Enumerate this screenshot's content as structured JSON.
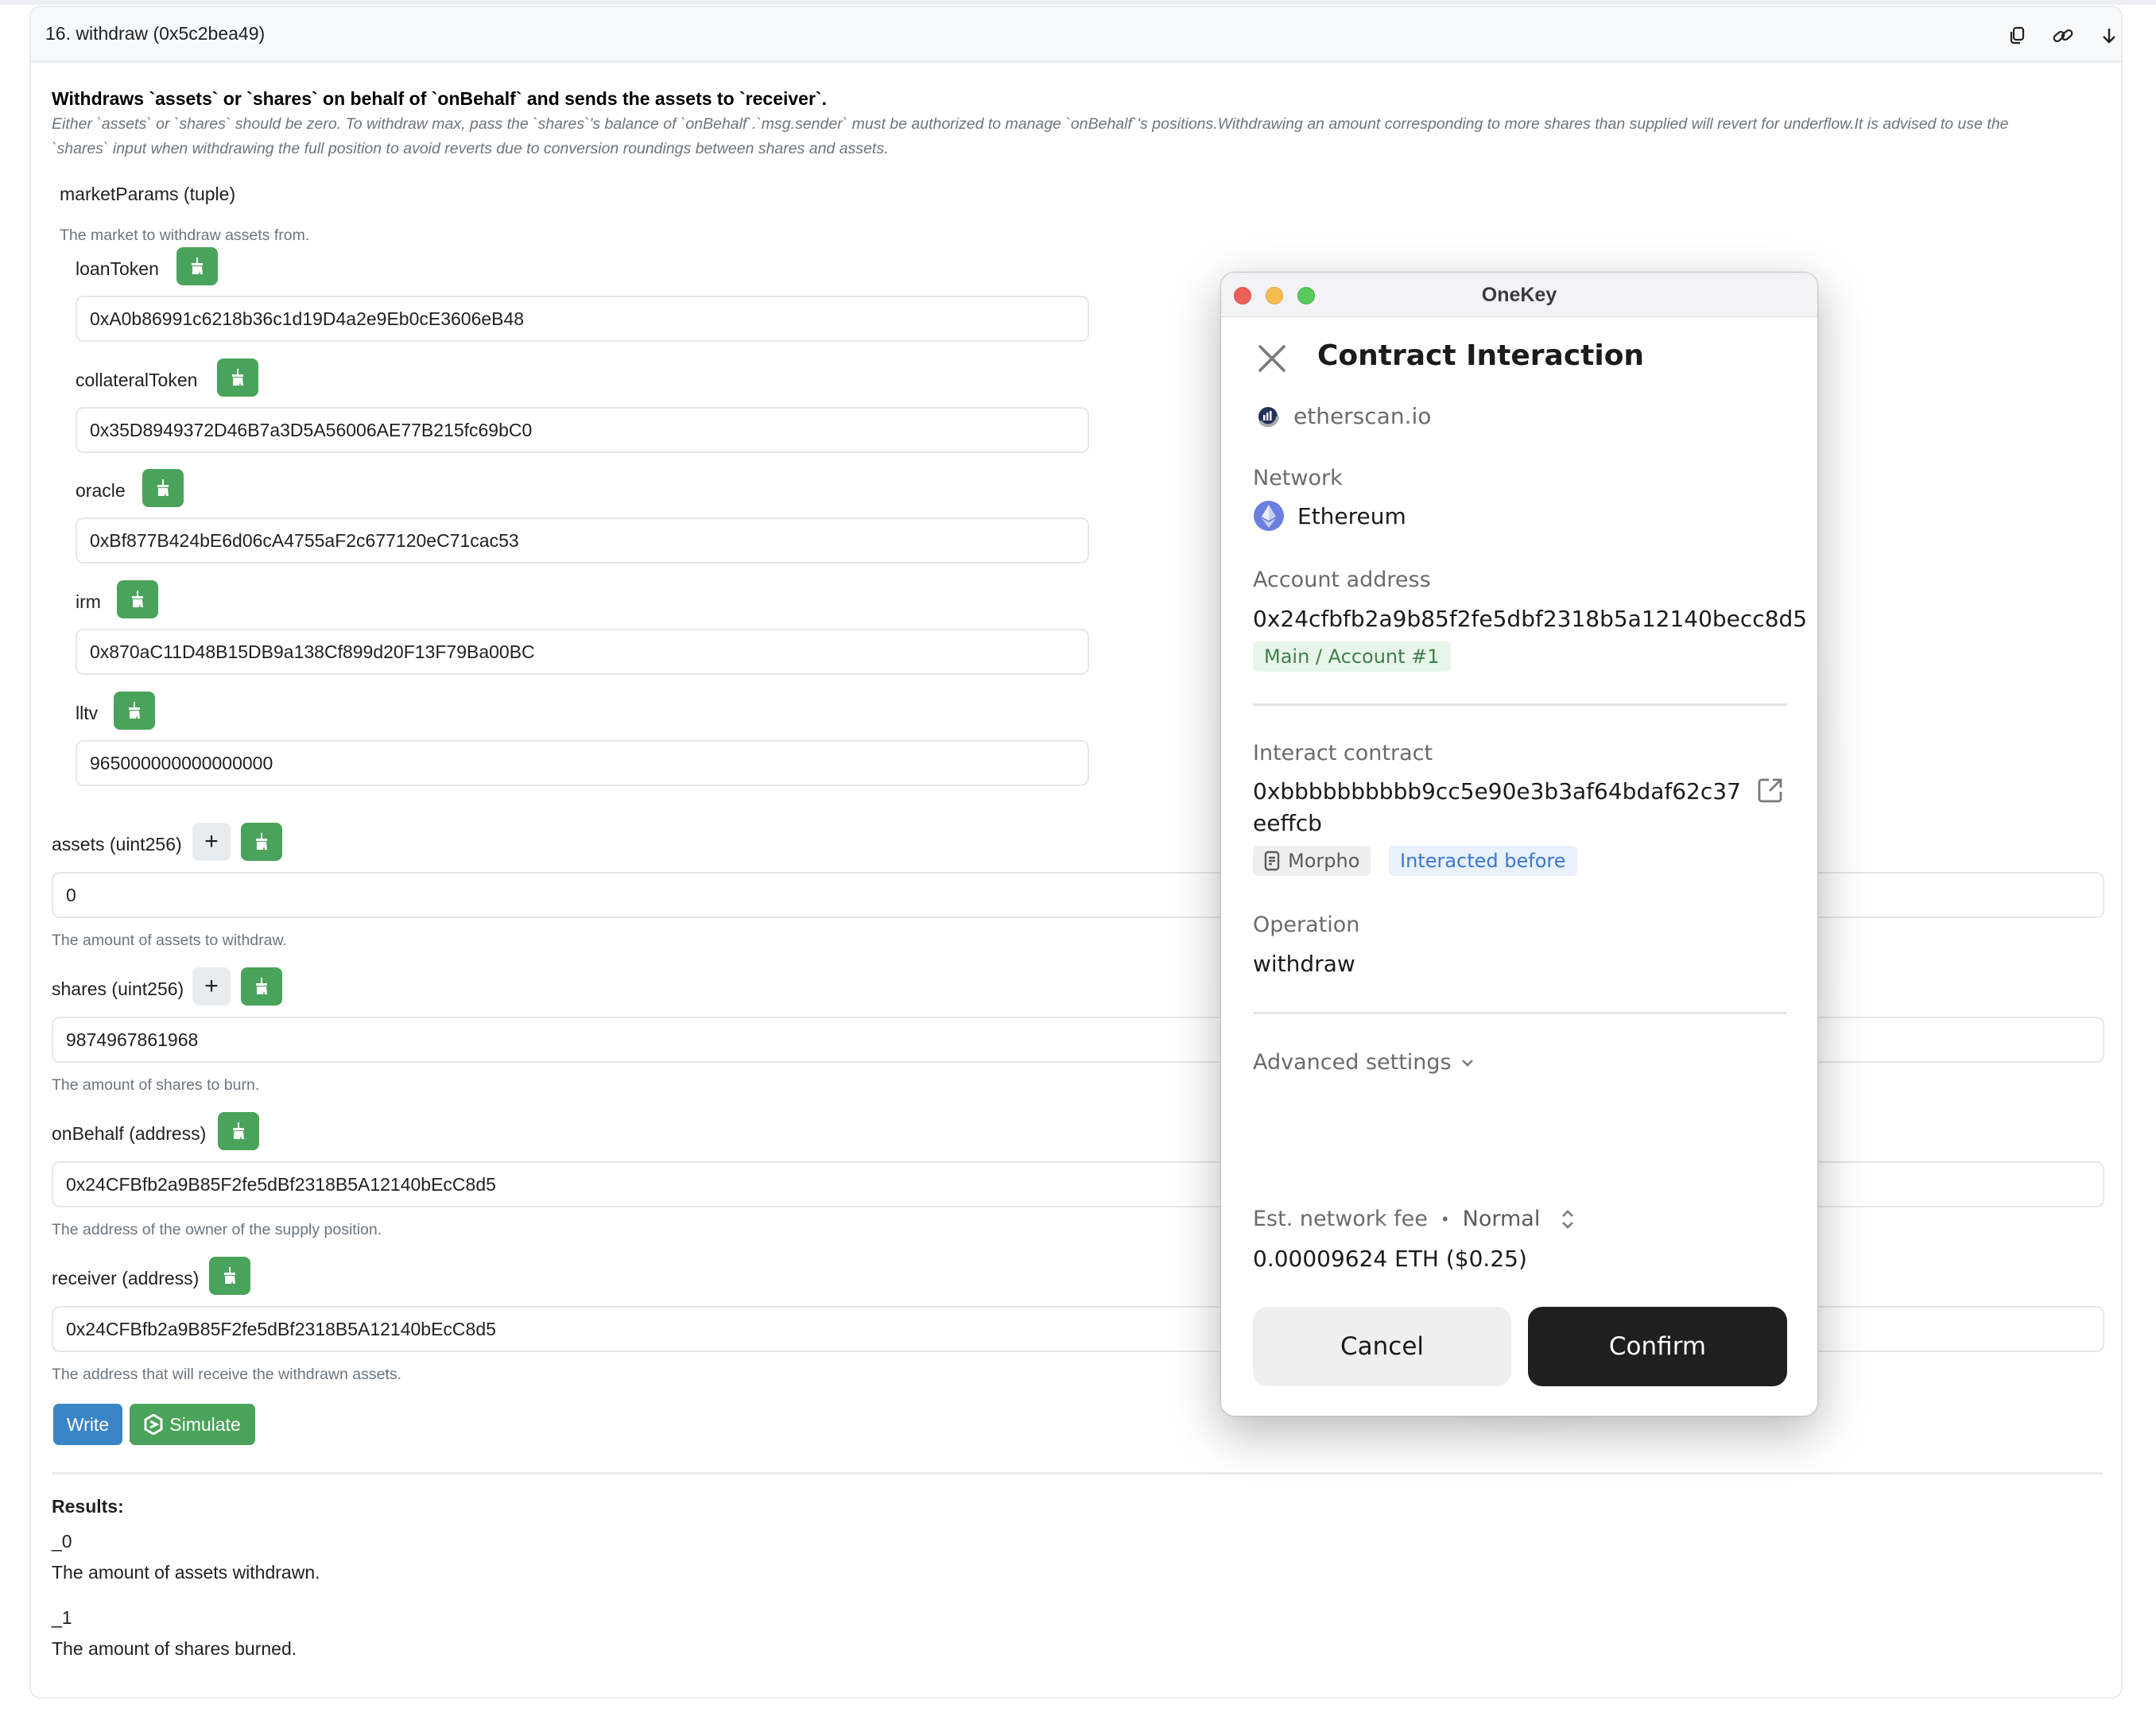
{
  "function_card": {
    "title": "16. withdraw (0x5c2bea49)",
    "header_icons": [
      "copy-icon",
      "link-icon",
      "arrow-down-icon"
    ],
    "description_bold": "Withdraws `assets` or `shares` on behalf of `onBehalf` and sends the assets to `receiver`.",
    "description_line1": "Either `assets` or `shares` should be zero. To withdraw max, pass the `shares`'s balance of `onBehalf`.`msg.sender` must be authorized to manage `onBehalf`'s positions.Withdrawing an amount corresponding to more shares than supplied will revert for underflow.It is advised to use the",
    "description_line2": "`shares` input when withdrawing the full position to avoid reverts due to conversion roundings between shares and assets.",
    "market_params": {
      "label": "marketParams (tuple)",
      "help": "The market to withdraw assets from.",
      "fields": [
        {
          "label": "loanToken",
          "value": "0xA0b86991c6218b36c1d19D4a2e9Eb0cE3606eB48"
        },
        {
          "label": "collateralToken",
          "value": "0x35D8949372D46B7a3D5A56006AE77B215fc69bC0"
        },
        {
          "label": "oracle",
          "value": "0xBf877B424bE6d06cA4755aF2c677120eC71cac53"
        },
        {
          "label": "irm",
          "value": "0x870aC11D48B15DB9a138Cf899d20F13F79Ba00BC"
        },
        {
          "label": "lltv",
          "value": "965000000000000000"
        }
      ]
    },
    "params": [
      {
        "label": "assets (uint256)",
        "value": "0",
        "help": "The amount of assets to withdraw.",
        "has_plus": true
      },
      {
        "label": "shares (uint256)",
        "value": "9874967861968",
        "help": "The amount of shares to burn.",
        "has_plus": true
      },
      {
        "label": "onBehalf (address)",
        "value": "0x24CFBfb2a9B85F2fe5dBf2318B5A12140bEcC8d5",
        "help": "The address of the owner of the supply position.",
        "has_plus": false
      },
      {
        "label": "receiver (address)",
        "value": "0x24CFBfb2a9B85F2fe5dBf2318B5A12140bEcC8d5",
        "help": "The address that will receive the withdrawn assets.",
        "has_plus": false
      }
    ],
    "plus_label": "+",
    "write_label": "Write",
    "simulate_label": "Simulate",
    "results": {
      "title": "Results:",
      "items": [
        {
          "name": "_0",
          "desc": "The amount of assets withdrawn."
        },
        {
          "name": "_1",
          "desc": "The amount of shares burned."
        }
      ]
    }
  },
  "dialog": {
    "window_title": "OneKey",
    "title": "Contract Interaction",
    "origin": "etherscan.io",
    "network_label": "Network",
    "network_value": "Ethereum",
    "account_label": "Account address",
    "account_value": "0x24cfbfb2a9b85f2fe5dbf2318b5a12140becc8d5",
    "account_badge": "Main / Account #1",
    "contract_label": "Interact contract",
    "contract_line1": "0xbbbbbbbbbb9cc5e90e3b3af64bdaf62c37",
    "contract_line2": "eeffcb",
    "contract_badge": "Morpho",
    "interacted_badge": "Interacted before",
    "operation_label": "Operation",
    "operation_value": "withdraw",
    "advanced_label": "Advanced settings",
    "fee_label": "Est. network fee",
    "fee_dot": "•",
    "fee_speed": "Normal",
    "fee_value": "0.00009624 ETH ($0.25)",
    "cancel_label": "Cancel",
    "confirm_label": "Confirm"
  },
  "colors": {
    "green_button": "#4aa35a",
    "write_blue": "#3a85c6",
    "confirm_black": "#1f1f1f",
    "account_badge_bg": "#e8f5ea",
    "account_badge_fg": "#3f7f4c",
    "interacted_bg": "#e8f1fc",
    "interacted_fg": "#3b78d0"
  }
}
